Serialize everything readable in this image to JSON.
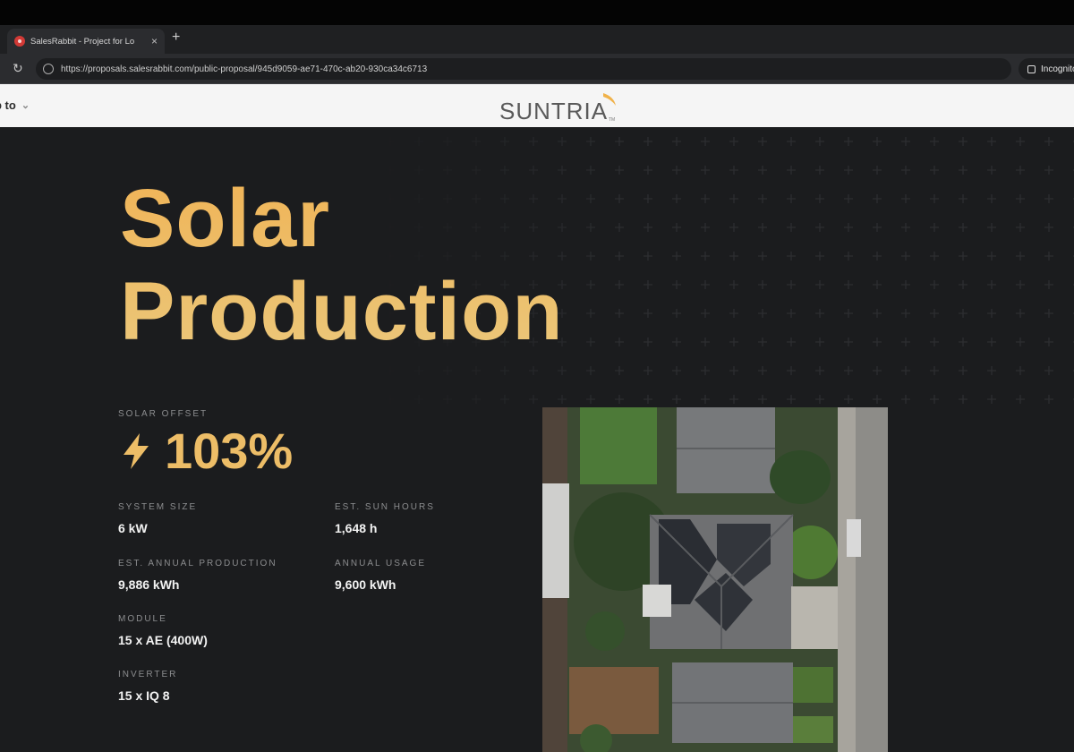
{
  "browser": {
    "tab_title": "SalesRabbit - Project for Lo",
    "tab_close": "×",
    "new_tab": "+",
    "reload": "↻",
    "url": "https://proposals.salesrabbit.com/public-proposal/945d9059-ae71-470c-ab20-930ca34c6713",
    "incognito_label": "Incognito"
  },
  "site": {
    "jump_label": "p to",
    "logo_text": "SUNTRIA",
    "logo_tm": "TM"
  },
  "page": {
    "title_line1": "Solar",
    "title_line2": "Production",
    "solar_offset_label": "SOLAR OFFSET",
    "solar_offset_value": "103%",
    "stats": {
      "system_size_label": "SYSTEM SIZE",
      "system_size_value": "6 kW",
      "sun_hours_label": "EST. SUN HOURS",
      "sun_hours_value": "1,648 h",
      "annual_production_label": "EST. ANNUAL PRODUCTION",
      "annual_production_value": "9,886 kWh",
      "annual_usage_label": "ANNUAL USAGE",
      "annual_usage_value": "9,600 kWh",
      "module_label": "MODULE",
      "module_value": "15 x AE (400W)",
      "inverter_label": "INVERTER",
      "inverter_value": "15 x IQ 8"
    }
  },
  "colors": {
    "accent": "#EDBD67",
    "background": "#1B1C1E",
    "header_bg": "#F5F5F5"
  },
  "icons": {
    "offset": "lightning-bolt-icon",
    "reload": "reload-icon",
    "lock": "lock-icon"
  }
}
